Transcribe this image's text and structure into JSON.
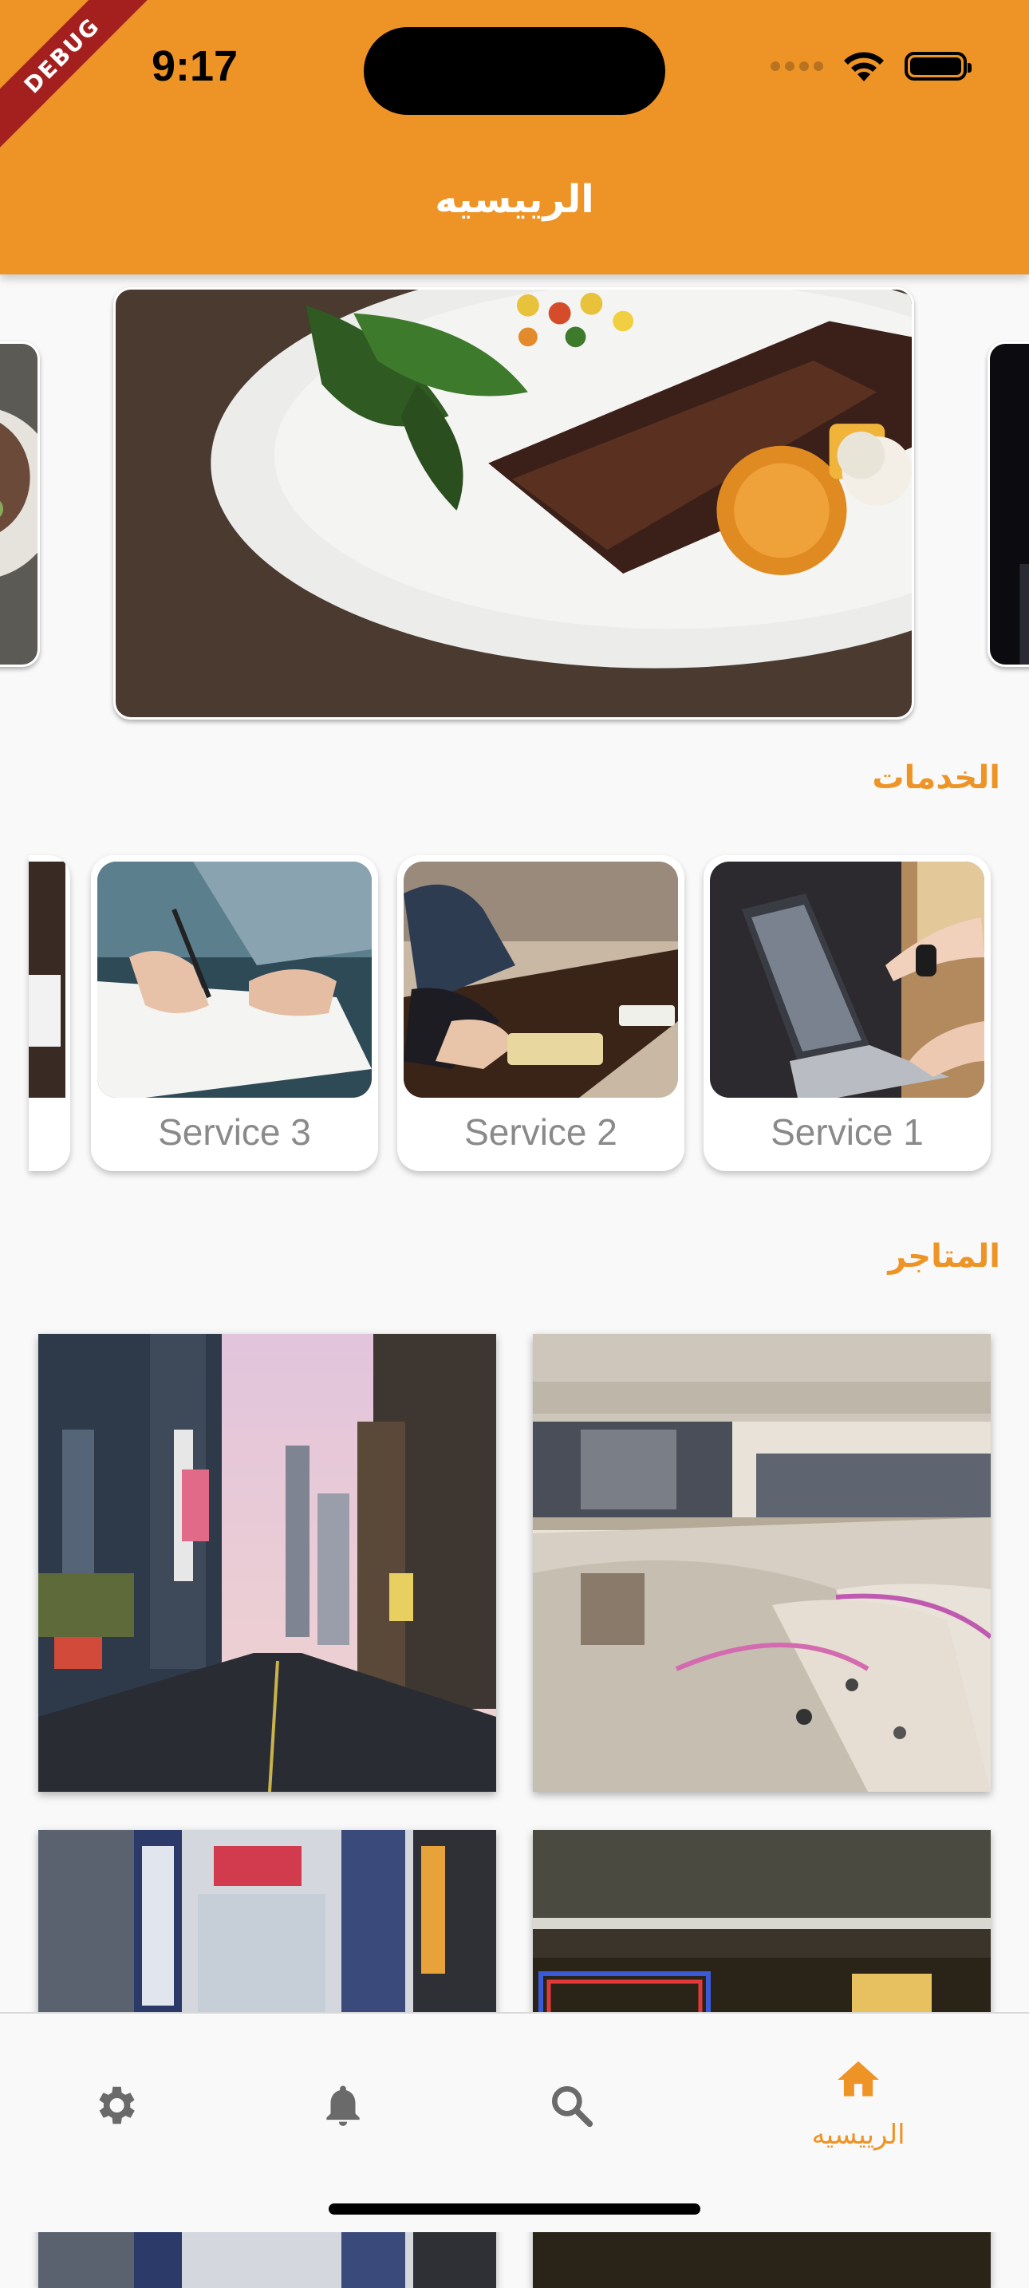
{
  "status_bar": {
    "time": "9:17"
  },
  "debug_banner": "DEBUG",
  "app_bar": {
    "title": "الرييسيه"
  },
  "sections": {
    "services_title": "الخدمات",
    "stores_title": "المتاجر"
  },
  "services": [
    {
      "label": "Service 1",
      "icon": "laptop-image"
    },
    {
      "label": "Service 2",
      "icon": "meeting-image"
    },
    {
      "label": "Service 3",
      "icon": "signing-image"
    }
  ],
  "bottom_nav": {
    "items": [
      {
        "label": "الرييسيه",
        "icon": "home-icon",
        "active": true
      },
      {
        "label": "",
        "icon": "search-icon"
      },
      {
        "label": "",
        "icon": "bell-icon"
      },
      {
        "label": "",
        "icon": "gear-icon"
      }
    ]
  },
  "colors": {
    "accent": "#ee9426",
    "background": "#f9f9f9",
    "inactive_icon": "#6a6a6a"
  }
}
